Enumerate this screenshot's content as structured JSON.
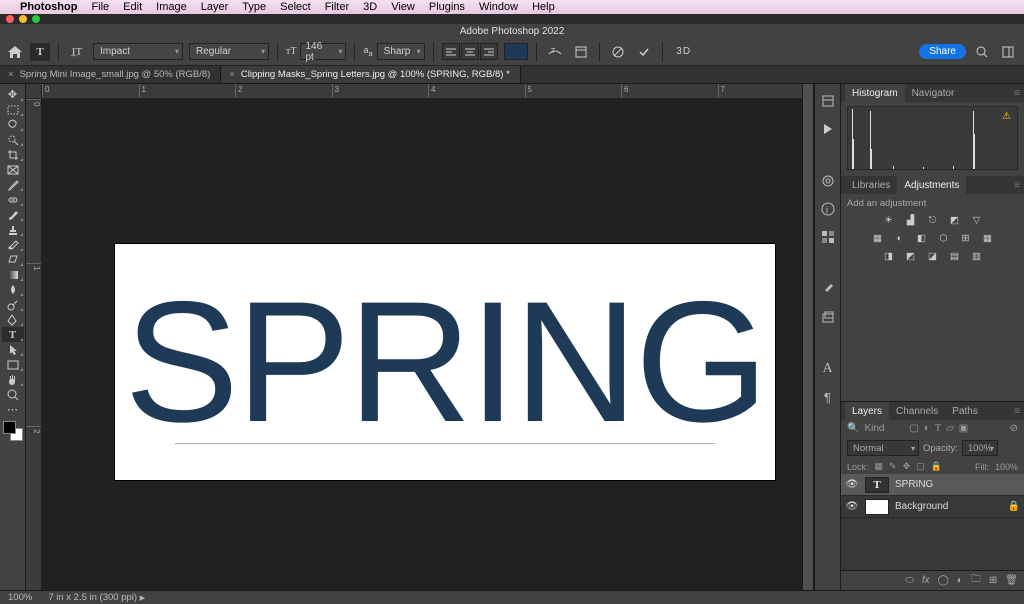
{
  "mac_menu": {
    "apple": "",
    "app": "Photoshop",
    "items": [
      "File",
      "Edit",
      "Image",
      "Layer",
      "Type",
      "Select",
      "Filter",
      "3D",
      "View",
      "Plugins",
      "Window",
      "Help"
    ]
  },
  "titlebar": "Adobe Photoshop 2022",
  "options": {
    "font": "Impact",
    "weight": "Regular",
    "size": "146 pt",
    "aa": "Sharp",
    "threeD": "3D"
  },
  "tabs": [
    {
      "label": "Spring Mini Image_small.jpg @ 50% (RGB/8)",
      "active": false
    },
    {
      "label": "Clipping Masks_Spring Letters.jpg @ 100% (SPRING, RGB/8) *",
      "active": true
    }
  ],
  "canvas_text": "SPRING",
  "hruler": [
    "0",
    "1",
    "2",
    "3",
    "4",
    "5",
    "6",
    "7"
  ],
  "vruler": [
    "0",
    "1",
    "2"
  ],
  "panels": {
    "top_tabs": [
      "Histogram",
      "Navigator"
    ],
    "mid_tabs": [
      "Libraries",
      "Adjustments"
    ],
    "adj_label": "Add an adjustment",
    "layers_tabs": [
      "Layers",
      "Channels",
      "Paths"
    ],
    "kind": "Kind",
    "blend": "Normal",
    "opacity_label": "Opacity:",
    "opacity": "100%",
    "lock_label": "Lock:",
    "fill_label": "Fill:",
    "fill": "100%",
    "layers": [
      {
        "name": "SPRING",
        "type": "text",
        "active": true
      },
      {
        "name": "Background",
        "type": "bg",
        "locked": true
      }
    ]
  },
  "share": "Share",
  "status": {
    "zoom": "100%",
    "dims": "7 in x 2.5 in (300 ppi)"
  }
}
